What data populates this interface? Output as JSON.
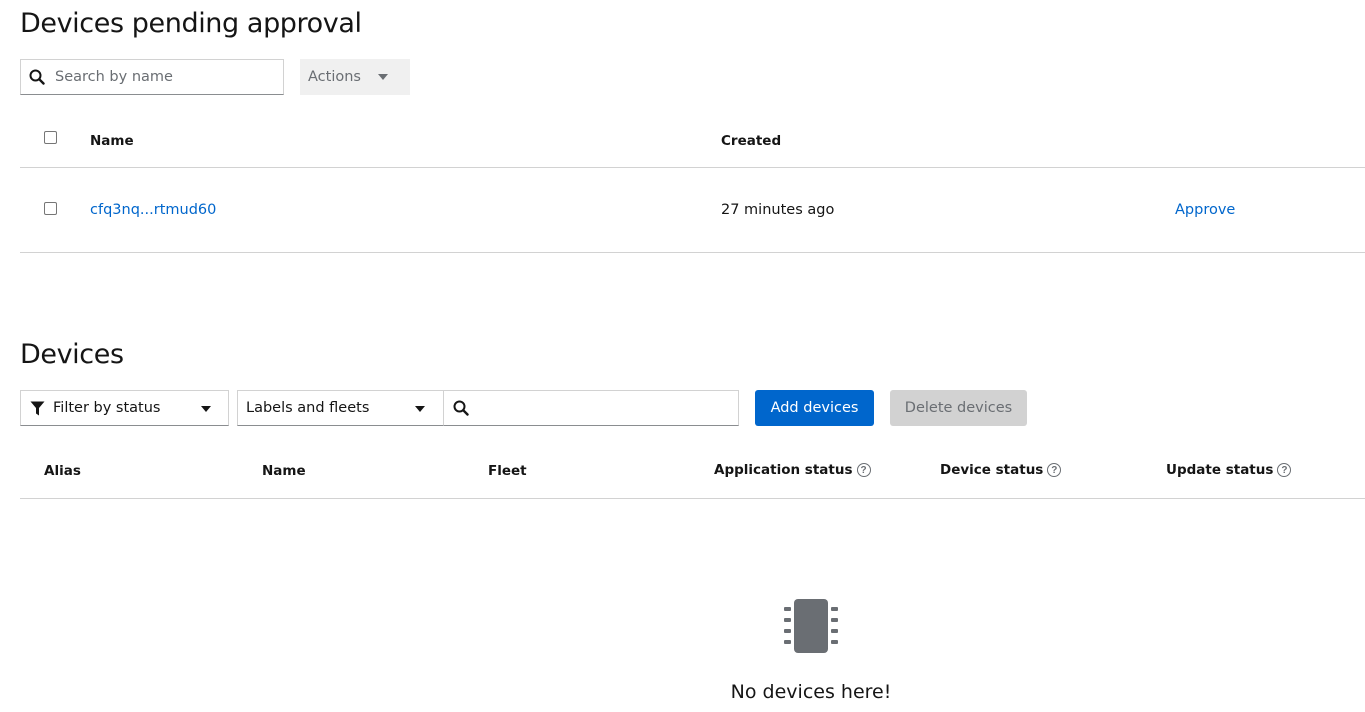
{
  "pending": {
    "title": "Devices pending approval",
    "search_placeholder": "Search by name",
    "actions_label": "Actions",
    "columns": {
      "name": "Name",
      "created": "Created"
    },
    "rows": [
      {
        "name": "cfq3nq...rtmud60",
        "created": "27 minutes ago",
        "action": "Approve"
      }
    ]
  },
  "devices": {
    "title": "Devices",
    "filter_label": "Filter by status",
    "labels_fleets_label": "Labels and fleets",
    "search_value": "",
    "add_button": "Add devices",
    "delete_button": "Delete devices",
    "columns": {
      "alias": "Alias",
      "name": "Name",
      "fleet": "Fleet",
      "app_status": "Application status",
      "device_status": "Device status",
      "update_status": "Update status"
    },
    "empty_icon": "microchip-icon",
    "empty_title": "No devices here!"
  },
  "colors": {
    "link": "#0066cc",
    "primary_button": "#0066cc",
    "disabled_button": "#d2d2d2",
    "border": "#d2d2d2"
  },
  "icons": {
    "search": "search-icon",
    "filter": "filter-icon",
    "caret": "caret-down-icon",
    "help": "question-circle-icon"
  }
}
